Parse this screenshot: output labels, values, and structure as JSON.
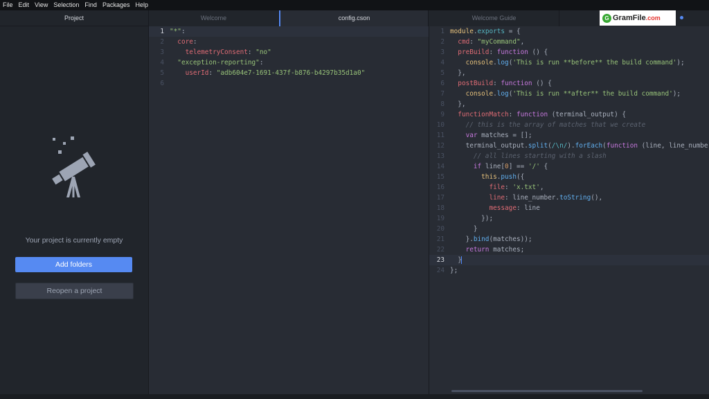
{
  "menu": [
    "File",
    "Edit",
    "View",
    "Selection",
    "Find",
    "Packages",
    "Help"
  ],
  "sidebar": {
    "title": "Project",
    "empty_message": "Your project is currently empty",
    "add_folders": "Add folders",
    "reopen_project": "Reopen a project"
  },
  "tabs_left": [
    "Welcome",
    "config.cson"
  ],
  "tabs_right": [
    "Welcome Guide"
  ],
  "watermark": {
    "brand": "GramFile",
    "suffix": ".com"
  },
  "config_lines": [
    {
      "n": "1",
      "t": "\"*\":"
    },
    {
      "n": "2",
      "t": "  core:"
    },
    {
      "n": "3",
      "t": "    telemetryConsent: \"no\""
    },
    {
      "n": "4",
      "t": "  \"exception-reporting\":"
    },
    {
      "n": "5",
      "t": "    userId: \"adb604e7-1691-437f-b876-b4297b35d1a0\""
    },
    {
      "n": "6",
      "t": ""
    }
  ],
  "script_lines": [
    {
      "n": "1",
      "t": "module.exports = {"
    },
    {
      "n": "2",
      "t": "  cmd: \"myCommand\","
    },
    {
      "n": "3",
      "t": "  preBuild: function () {"
    },
    {
      "n": "4",
      "t": "    console.log('This is run **before** the build command');"
    },
    {
      "n": "5",
      "t": "  },"
    },
    {
      "n": "6",
      "t": "  postBuild: function () {"
    },
    {
      "n": "7",
      "t": "    console.log('This is run **after** the build command');"
    },
    {
      "n": "8",
      "t": "  },"
    },
    {
      "n": "9",
      "t": "  functionMatch: function (terminal_output) {"
    },
    {
      "n": "10",
      "t": "    // this is the array of matches that we create"
    },
    {
      "n": "11",
      "t": "    var matches = [];"
    },
    {
      "n": "12",
      "t": "    terminal_output.split(/\\n/).forEach(function (line, line_number,"
    },
    {
      "n": "13",
      "t": "      // all lines starting with a slash"
    },
    {
      "n": "14",
      "t": "      if line[0] == '/' {"
    },
    {
      "n": "15",
      "t": "        this.push({"
    },
    {
      "n": "16",
      "t": "          file: 'x.txt',"
    },
    {
      "n": "17",
      "t": "          line: line_number.toString(),"
    },
    {
      "n": "18",
      "t": "          message: line"
    },
    {
      "n": "19",
      "t": "        });"
    },
    {
      "n": "20",
      "t": "      }"
    },
    {
      "n": "21",
      "t": "    }.bind(matches));"
    },
    {
      "n": "22",
      "t": "    return matches;"
    },
    {
      "n": "23",
      "t": "  }"
    },
    {
      "n": "24",
      "t": "};"
    }
  ],
  "colors": {
    "accent": "#568af2",
    "editor_bg": "#282c34",
    "sidebar_bg": "#21252b"
  }
}
